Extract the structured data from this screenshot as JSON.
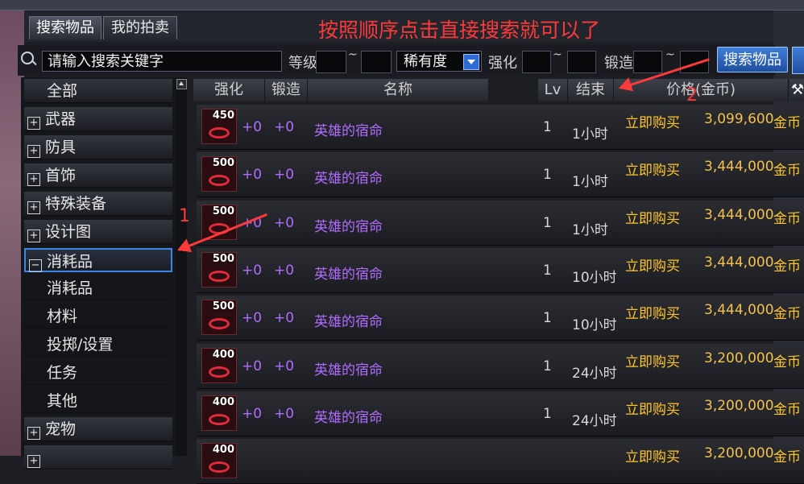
{
  "tabs": [
    {
      "label": "搜索物品"
    },
    {
      "label": "我的拍卖"
    }
  ],
  "annotation": {
    "note": "按照顺序点击直接搜索就可以了",
    "step1": "1",
    "step2": "2"
  },
  "search": {
    "placeholder": "请输入搜索关键字",
    "level_label": "等级",
    "tilde": "~",
    "rarity_value": "稀有度",
    "enhance_label": "强化",
    "forge_label": "锻造",
    "search_button": "搜索物品"
  },
  "sidebar": {
    "items": [
      {
        "label": "全部",
        "type": "plain"
      },
      {
        "label": "武器",
        "type": "collapsed"
      },
      {
        "label": "防具",
        "type": "collapsed"
      },
      {
        "label": "首饰",
        "type": "collapsed"
      },
      {
        "label": "特殊装备",
        "type": "collapsed"
      },
      {
        "label": "设计图",
        "type": "collapsed"
      },
      {
        "label": "消耗品",
        "type": "expanded"
      },
      {
        "label": "消耗品",
        "type": "sub"
      },
      {
        "label": "材料",
        "type": "sub"
      },
      {
        "label": "投掷/设置",
        "type": "sub"
      },
      {
        "label": "任务",
        "type": "sub"
      },
      {
        "label": "其他",
        "type": "sub"
      },
      {
        "label": "宠物",
        "type": "collapsed"
      },
      {
        "label": "",
        "type": "collapsed"
      }
    ]
  },
  "table": {
    "columns": {
      "enhance": "强化",
      "forge": "锻造",
      "name": "名称",
      "lv": "Lv",
      "end": "结束",
      "price": "价格(金币)"
    },
    "rows": [
      {
        "qty": "450",
        "enhance": "+0",
        "forge": "+0",
        "name": "英雄的宿命",
        "lv": "1",
        "end": "1小时",
        "action": "立即购买",
        "price": "3,099,600",
        "currency": "金币"
      },
      {
        "qty": "500",
        "enhance": "+0",
        "forge": "+0",
        "name": "英雄的宿命",
        "lv": "1",
        "end": "1小时",
        "action": "立即购买",
        "price": "3,444,000",
        "currency": "金币"
      },
      {
        "qty": "500",
        "enhance": "+0",
        "forge": "+0",
        "name": "英雄的宿命",
        "lv": "1",
        "end": "1小时",
        "action": "立即购买",
        "price": "3,444,000",
        "currency": "金币"
      },
      {
        "qty": "500",
        "enhance": "+0",
        "forge": "+0",
        "name": "英雄的宿命",
        "lv": "1",
        "end": "10小时",
        "action": "立即购买",
        "price": "3,444,000",
        "currency": "金币"
      },
      {
        "qty": "500",
        "enhance": "+0",
        "forge": "+0",
        "name": "英雄的宿命",
        "lv": "1",
        "end": "10小时",
        "action": "立即购买",
        "price": "3,444,000",
        "currency": "金币"
      },
      {
        "qty": "400",
        "enhance": "+0",
        "forge": "+0",
        "name": "英雄的宿命",
        "lv": "1",
        "end": "24小时",
        "action": "立即购买",
        "price": "3,200,000",
        "currency": "金币"
      },
      {
        "qty": "400",
        "enhance": "+0",
        "forge": "+0",
        "name": "英雄的宿命",
        "lv": "1",
        "end": "24小时",
        "action": "立即购买",
        "price": "3,200,000",
        "currency": "金币"
      },
      {
        "qty": "400",
        "enhance": "",
        "forge": "",
        "name": "",
        "lv": "",
        "end": "",
        "action": "立即购买",
        "price": "3,200,000",
        "currency": "金币"
      }
    ]
  },
  "colors": {
    "annotation": "#ff3a3a",
    "item_name": "#b06cff",
    "price": "#ffc52a",
    "accent": "#3e86e8"
  }
}
